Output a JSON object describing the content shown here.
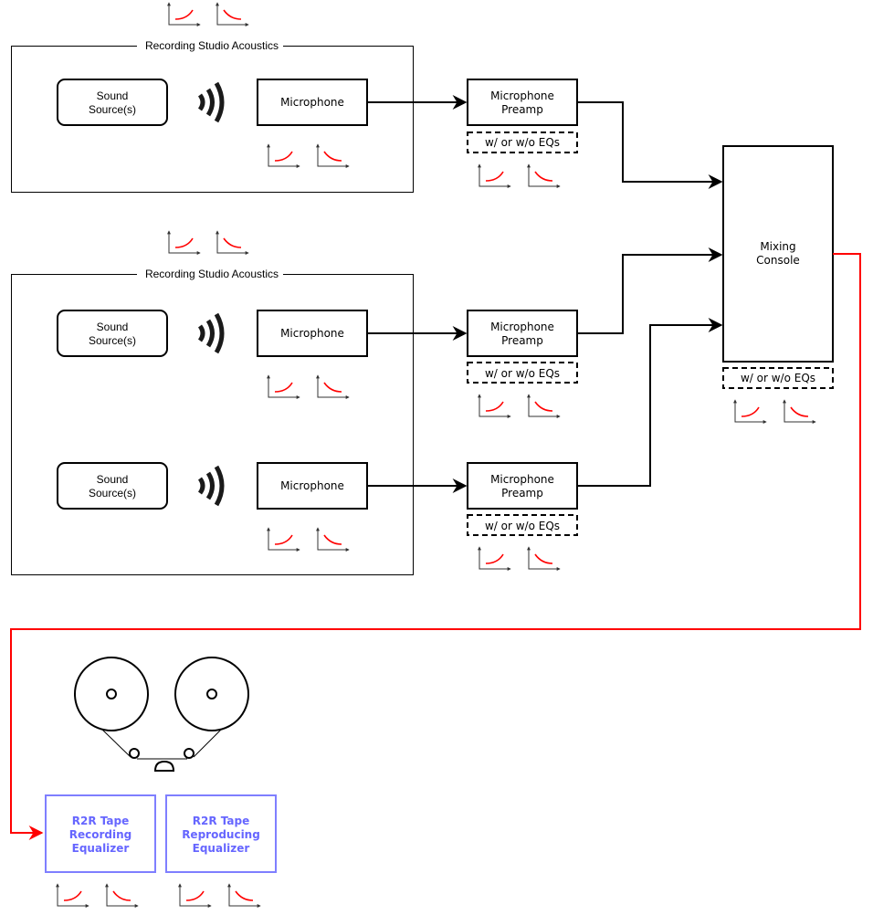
{
  "diagram": {
    "groups": [
      {
        "id": "studio-1",
        "label": "Recording Studio Acoustics"
      },
      {
        "id": "studio-2",
        "label": "Recording Studio Acoustics"
      }
    ],
    "sound_source_label": [
      "Sound",
      "Source(s)"
    ],
    "microphone_label": "Microphone",
    "preamp_label": [
      "Microphone",
      "Preamp"
    ],
    "eq_note": "w/ or w/o EQs",
    "mixer_label": [
      "Mixing",
      "Console"
    ],
    "tape_recording_eq_label": [
      "R2R Tape",
      "Recording",
      "Equalizer"
    ],
    "tape_reproducing_eq_label": [
      "R2R Tape",
      "Reproducing",
      "Equalizer"
    ],
    "icons": {
      "sound_wave": "sound-waves-icon",
      "rising_curve": "rising-response-curve-icon",
      "falling_curve": "falling-response-curve-icon",
      "tape_deck": "reel-to-reel-tape-icon"
    },
    "colors": {
      "line": "#000000",
      "output_signal": "#ff0000",
      "curve": "#ff0000",
      "tape_eq": "#6666ff",
      "tape_eq_border": "#7f7fff"
    }
  }
}
